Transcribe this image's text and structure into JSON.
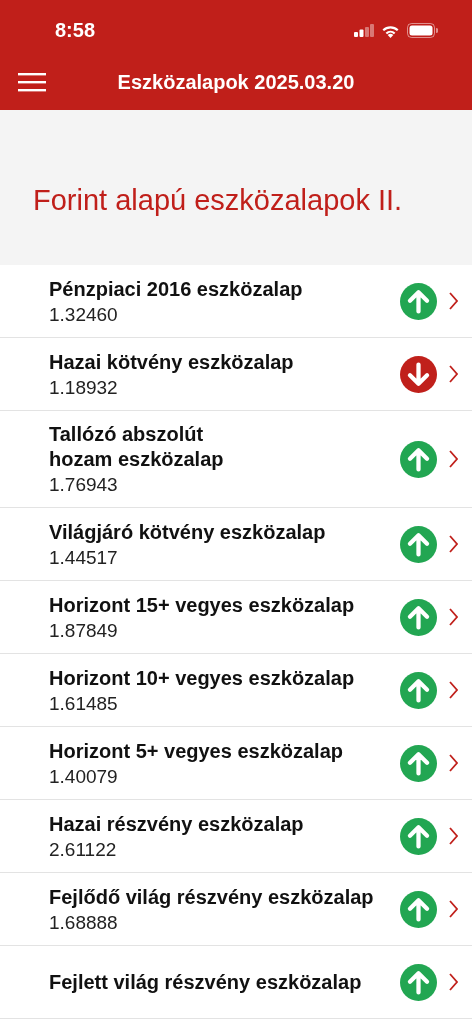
{
  "status_bar": {
    "time": "8:58"
  },
  "nav_bar": {
    "title": "Eszközalapok 2025.03.20"
  },
  "section": {
    "title": "Forint alapú eszközalapok II."
  },
  "funds": [
    {
      "name": "Pénzpiaci 2016 eszközalap",
      "value": "1.32460",
      "rising": true
    },
    {
      "name": "Hazai kötvény eszközalap",
      "value": "1.18932",
      "rising": false
    },
    {
      "name": "Tallózó abszolút\nhozam eszközalap",
      "value": "1.76943",
      "rising": true
    },
    {
      "name": "Világjáró kötvény eszközalap",
      "value": "1.44517",
      "rising": true
    },
    {
      "name": "Horizont 15+ vegyes eszközalap",
      "value": "1.87849",
      "rising": true
    },
    {
      "name": "Horizont 10+ vegyes eszközalap",
      "value": "1.61485",
      "rising": true
    },
    {
      "name": "Horizont 5+ vegyes eszközalap",
      "value": "1.40079",
      "rising": true
    },
    {
      "name": "Hazai részvény eszközalap",
      "value": "2.61122",
      "rising": true
    },
    {
      "name": "Fejlődő világ részvény eszközalap",
      "value": "1.68888",
      "rising": true
    },
    {
      "name": "Fejlett világ részvény eszközalap",
      "rising": true
    }
  ]
}
